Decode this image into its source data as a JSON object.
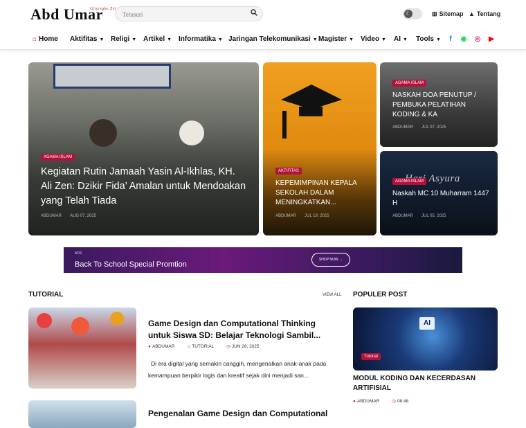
{
  "header": {
    "logo_text": "Abd Umar",
    "logo_tagline": "Ginengke Zet Allehlas",
    "search_placeholder": "Telusuri",
    "links": [
      {
        "label": "Sitemap"
      },
      {
        "label": "Tentang"
      }
    ]
  },
  "nav": {
    "items": [
      {
        "label": "Home"
      },
      {
        "label": "Aktifitas"
      },
      {
        "label": "Religi"
      },
      {
        "label": "Artikel"
      },
      {
        "label": "Informatika"
      },
      {
        "label": "Jaringan Telekomunikasi"
      },
      {
        "label": "Magister"
      },
      {
        "label": "Video"
      },
      {
        "label": "AI"
      },
      {
        "label": "Tools"
      }
    ],
    "social": [
      {
        "name": "facebook-icon",
        "glyph": "f",
        "color": "#1877f2"
      },
      {
        "name": "whatsapp-icon",
        "glyph": "◉",
        "color": "#25d366"
      },
      {
        "name": "instagram-icon",
        "glyph": "◎",
        "color": "#e1306c"
      },
      {
        "name": "youtube-icon",
        "glyph": "▶",
        "color": "#ff0000"
      }
    ]
  },
  "featured": [
    {
      "category": "AGAMA ISLAM",
      "title": "Kegiatan Rutin Jamaah Yasin Al-Ikhlas, KH. Ali Zen: Dzikir Fida’ Amalan untuk Mendoakan yang Telah Tiada",
      "author": "ABDUMAR",
      "date": "AUG 07, 2025"
    },
    {
      "category": "AKTIFITAS",
      "title": "KEPEMIMPINAN KEPALA SEKOLAH DALAM MENINGKATKAN...",
      "author": "ABDUMAR",
      "date": "JUL 19, 2025"
    },
    {
      "category": "AGAMA ISLAM",
      "title": "NASKAH DOA PENUTUP / PEMBUKA PELATIHAN KODING & KA",
      "author": "ABDUMAR",
      "date": "JUL 07, 2025"
    },
    {
      "category": "AGAMA ISLAM",
      "title": "Naskah MC 10 Muharram 1447 H",
      "author": "ABDUMAR",
      "date": "JUL 05, 2025",
      "bg_text": "Hari Asyura"
    }
  ],
  "ads": {
    "label": "ADS",
    "text": "Back To School Special Promtion",
    "button": "SHOP NOW →"
  },
  "tutorial": {
    "section_title": "TUTORIAL",
    "view_all": "VIEW ALL",
    "posts": [
      {
        "title": "Game Design dan Computational Thinking untuk Siswa SD: Belajar Teknologi Sambil...",
        "author": "ABDUMAR",
        "category": "TUTORIAL",
        "date": "JUN 28, 2025",
        "excerpt": "Di era digital yang semakin canggih, mengenalkan anak-anak pada kemampuan berpikir logis dan kreatif sejak dini menjadi san..."
      },
      {
        "title": "Pengenalan Game Design dan Computational"
      }
    ]
  },
  "popular": {
    "section_title": "POPULER POST",
    "post": {
      "category": "Tutorial",
      "title": "MODUL KODING DAN KECERDASAN ARTIFISIAL",
      "author": "ABDUMAR",
      "time": "08:48",
      "img_text": "AI"
    }
  }
}
